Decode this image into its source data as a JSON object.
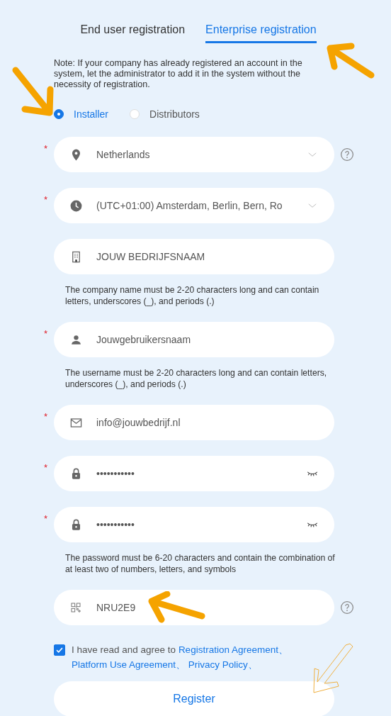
{
  "tabs": [
    {
      "label": "End user registration",
      "selected": false
    },
    {
      "label": "Enterprise registration",
      "selected": true
    }
  ],
  "note": "Note: If your company has already registered an account in the system, let the administrator to add it in the system without the necessity of registration.",
  "roles": [
    {
      "label": "Installer",
      "selected": true
    },
    {
      "label": "Distributors",
      "selected": false
    }
  ],
  "fields": [
    {
      "kind": "country",
      "required_mark": "*",
      "value": "Netherlands",
      "help": true
    },
    {
      "kind": "timezone",
      "required_mark": "*",
      "value": "(UTC+01:00) Amsterdam, Berlin, Bern, Ro"
    },
    {
      "kind": "company",
      "value": "JOUW BEDRIJFSNAAM",
      "hint": "The company name must be 2-20 characters long and can contain letters, underscores (_), and periods (.)"
    },
    {
      "kind": "username",
      "required_mark": "*",
      "value": "Jouwgebruikersnaam",
      "hint": "The username must be 2-20 characters long and can contain letters, underscores (_), and periods (.)"
    },
    {
      "kind": "email",
      "required_mark": "*",
      "value": "info@jouwbedrijf.nl"
    },
    {
      "kind": "password",
      "required_mark": "*",
      "value": "•••••••••••"
    },
    {
      "kind": "password",
      "required_mark": "*",
      "value": "•••••••••••",
      "hint": "The password must be 6-20 characters and contain the combination of at least two of numbers, letters, and symbols"
    },
    {
      "kind": "code",
      "value": "NRU2E9",
      "help": true
    }
  ],
  "agreement": {
    "checked": true,
    "text": "I have read and agree to ",
    "links": [
      "Registration Agreement、",
      "Platform Use Agreement、",
      "Privacy Policy、"
    ]
  },
  "submit_button": "Register"
}
